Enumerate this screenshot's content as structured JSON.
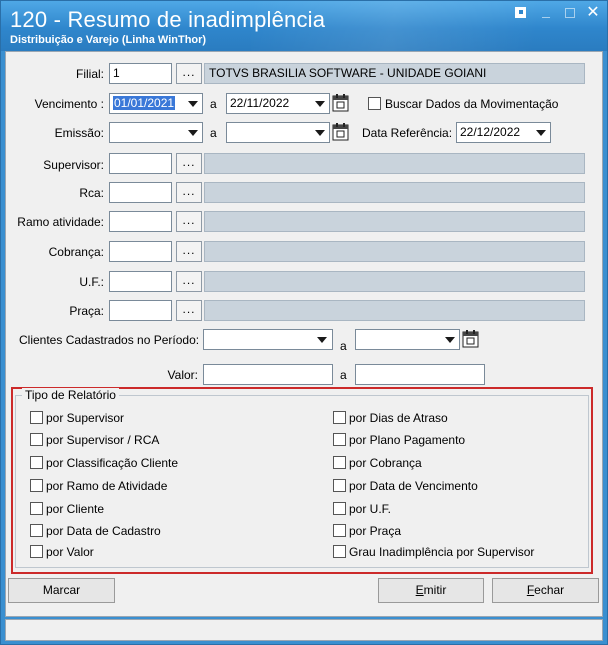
{
  "window": {
    "title": "120 - Resumo de inadimplência",
    "subtitle": "Distribuição e Varejo (Linha WinThor)"
  },
  "filters": {
    "filial": {
      "label": "Filial:",
      "value": "1",
      "description": "TOTVS BRASILIA SOFTWARE - UNIDADE GOIANI"
    },
    "vencimento": {
      "label": "Vencimento :",
      "start": "01/01/2021",
      "sep": "a",
      "end": "22/11/2022"
    },
    "buscar_dados": {
      "label": "Buscar Dados da Movimentação",
      "checked": false
    },
    "emissao": {
      "label": "Emissão:",
      "start": "",
      "sep": "a",
      "end": ""
    },
    "data_referencia": {
      "label": "Data Referência:",
      "value": "22/12/2022"
    },
    "supervisor": {
      "label": "Supervisor:",
      "value": "",
      "description": ""
    },
    "rca": {
      "label": "Rca:",
      "value": "",
      "description": ""
    },
    "ramo_atividade": {
      "label": "Ramo atividade:",
      "value": "",
      "description": ""
    },
    "cobranca": {
      "label": "Cobrança:",
      "value": "",
      "description": ""
    },
    "uf": {
      "label": "U.F.:",
      "value": "",
      "description": ""
    },
    "praca": {
      "label": "Praça:",
      "value": "",
      "description": ""
    },
    "clientes_periodo": {
      "label": "Clientes Cadastrados no Período:",
      "start": "",
      "sep": "a",
      "end": ""
    },
    "valor": {
      "label": "Valor:",
      "start": "",
      "sep": "a",
      "end": ""
    }
  },
  "tipo_relatorio": {
    "legend": "Tipo de Relatório",
    "left": [
      {
        "label": "por Supervisor",
        "checked": false
      },
      {
        "label": "por Supervisor / RCA",
        "checked": false
      },
      {
        "label": "por Classificação Cliente",
        "checked": false
      },
      {
        "label": "por Ramo de Atividade",
        "checked": false
      },
      {
        "label": "por Cliente",
        "checked": false
      },
      {
        "label": "por Data de Cadastro",
        "checked": false
      },
      {
        "label": "por Valor",
        "checked": false
      }
    ],
    "right": [
      {
        "label": "por Dias de Atraso",
        "checked": false
      },
      {
        "label": "por Plano Pagamento",
        "checked": false
      },
      {
        "label": "por Cobrança",
        "checked": false
      },
      {
        "label": "por Data de Vencimento",
        "checked": false
      },
      {
        "label": "por U.F.",
        "checked": false
      },
      {
        "label": "por Praça",
        "checked": false
      },
      {
        "label": "Grau Inadimplência por Supervisor",
        "checked": false
      }
    ]
  },
  "buttons": {
    "marcar": "Marcar",
    "emitir_pre": "",
    "emitir_u": "E",
    "emitir_post": "mitir",
    "fechar_pre": "",
    "fechar_u": "F",
    "fechar_post": "echar"
  },
  "colors": {
    "titlebar": "#2f86cc",
    "readonly_field": "#c9d3dc",
    "highlight_border": "#cc2a2a",
    "selection": "#3a78d8"
  },
  "icons": {
    "dots": "ellipsis",
    "dropdown": "chevron-down-icon",
    "calendar": "calendar-icon"
  }
}
